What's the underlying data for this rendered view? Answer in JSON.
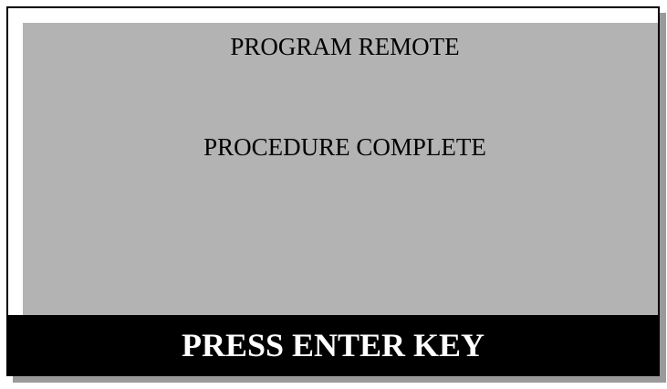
{
  "screen": {
    "title": "PROGRAM REMOTE",
    "message": "PROCEDURE COMPLETE"
  },
  "footer": {
    "prompt": "PRESS ENTER KEY"
  },
  "colors": {
    "display_background": "#b3b3b3",
    "footer_background": "#000000",
    "footer_text": "#ffffff"
  }
}
